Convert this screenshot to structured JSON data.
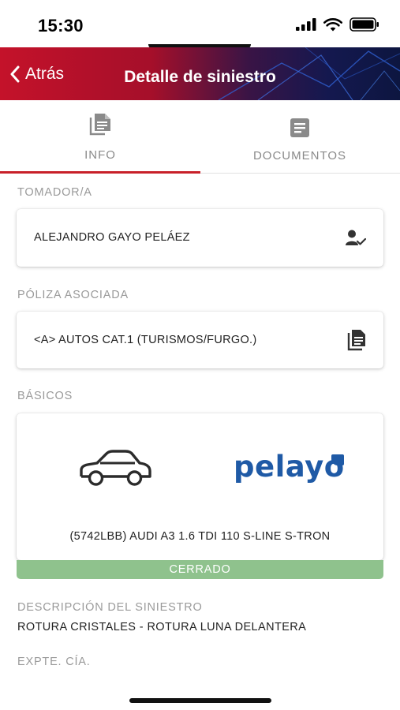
{
  "status_bar": {
    "time": "15:30"
  },
  "nav": {
    "back_label": "Atrás",
    "title": "Detalle de siniestro"
  },
  "tabs": [
    {
      "label": "INFO",
      "icon": "document-stack-icon",
      "active": true
    },
    {
      "label": "DOCUMENTOS",
      "icon": "document-icon",
      "active": false
    }
  ],
  "tomador": {
    "label": "TOMADOR/A",
    "value": "ALEJANDRO GAYO PELÁEZ",
    "icon": "person-check-icon"
  },
  "poliza": {
    "label": "PÓLIZA ASOCIADA",
    "value": "<A> AUTOS CAT.1 (TURISMOS/FURGO.)",
    "icon": "document-icon"
  },
  "basicos": {
    "label": "BÁSICOS",
    "vehicle": "(5742LBB) AUDI A3 1.6 TDI 110 S-LINE S-TRON",
    "brand": "pelayo",
    "status": "CERRADO"
  },
  "descripcion": {
    "label": "DESCRIPCIÓN DEL SINIESTRO",
    "value": "ROTURA CRISTALES - ROTURA LUNA DELANTERA"
  },
  "expte": {
    "label": "EXPTE. CÍA."
  },
  "colors": {
    "accent": "#c8202a",
    "status_closed": "#8fc28d",
    "brand_blue": "#1f5aa6"
  }
}
